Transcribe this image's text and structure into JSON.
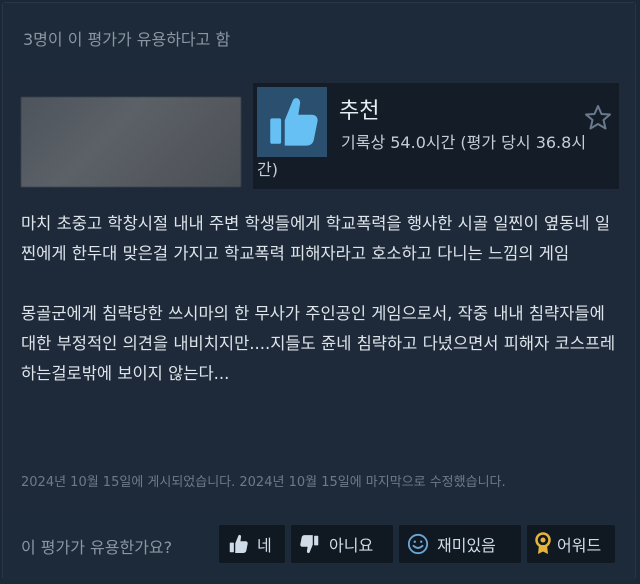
{
  "review": {
    "helpful_count_text": "3명이 이 평가가 유용하다고 함",
    "recommendation": "추천",
    "hours_text": "기록상 54.0시간 (평가 당시 36.8시간)",
    "paragraphs": [
      "마치 초중고 학창시절 내내 주변 학생들에게 학교폭력을 행사한 시골 일찐이 옆동네 일찐에게 한두대 맞은걸 가지고 학교폭력 피해자라고 호소하고 다니는 느낌의 게임",
      "몽골군에게 침략당한 쓰시마의 한 무사가 주인공인 게임으로서, 작중 내내 침략자들에 대한 부정적인 의견을 내비치지만....지들도 쥰네 침략하고 다녔으면서 피해자 코스프레 하는걸로밖에 보이지 않는다..."
    ],
    "posted_text": "2024년 10월 15일에 게시되었습니다. 2024년 10월 15일에 마지막으로 수정했습니다."
  },
  "footer": {
    "question": "이 평가가 유용한가요?",
    "yes_label": "네",
    "no_label": "아니요",
    "funny_label": "재미있음",
    "award_label": "어워드"
  },
  "icons": {
    "thumb": "thumbs-up-icon",
    "star": "star-outline-icon",
    "award": "award-ribbon-icon"
  },
  "colors": {
    "thumb_tile": "#2b4f6e",
    "thumb_icon": "#66c0f4",
    "award": "#e5b53b"
  }
}
